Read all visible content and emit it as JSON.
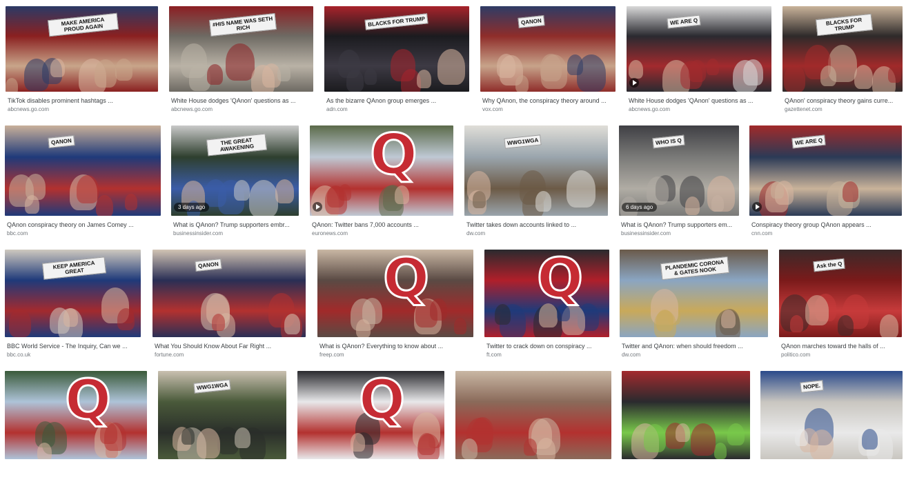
{
  "results": [
    {
      "title": "TikTok disables prominent hashtags ...",
      "source": "abcnews.go.com",
      "sign": "MAKE AMERICA PROUD AGAIN",
      "palette": [
        "#8a2020",
        "#c8a58a",
        "#2b3a66"
      ]
    },
    {
      "title": "White House dodges 'QAnon' questions as ...",
      "source": "abcnews.go.com",
      "sign": "#HIS NAME WAS SETH RICH",
      "palette": [
        "#6e6a63",
        "#b9b2a6",
        "#8c1f23"
      ]
    },
    {
      "title": "As the bizarre QAnon group emerges ...",
      "source": "adn.com",
      "sign": "BLACKS FOR TRUMP",
      "palette": [
        "#1b1b1f",
        "#3d3a44",
        "#a8232b"
      ]
    },
    {
      "title": "Why QAnon, the conspiracy theory around ...",
      "source": "vox.com",
      "sign": "QANON",
      "palette": [
        "#8f2d2a",
        "#c7a38a",
        "#2f3c66"
      ]
    },
    {
      "title": "White House dodges 'QAnon' questions as ...",
      "source": "abcnews.go.com",
      "sign": "WE ARE Q",
      "palette": [
        "#2a2a30",
        "#a32a2e",
        "#d9d9d9"
      ],
      "video": true
    },
    {
      "title": "QAnon' conspiracy theory gains curre...",
      "source": "gazettenet.com",
      "sign": "BLACKS FOR TRUMP",
      "palette": [
        "#2e2a2a",
        "#a12a2a",
        "#c9b39a"
      ]
    },
    {
      "title": "QAnon conspiracy theory on James Comey ...",
      "source": "bbc.com",
      "sign": "QANON",
      "palette": [
        "#1f3a7a",
        "#b3312f",
        "#c9b09a"
      ]
    },
    {
      "title": "What is QAnon? Trump supporters embr...",
      "source": "businessinsider.com",
      "sign": "THE GREAT AWAKENING",
      "palette": [
        "#2e3f2e",
        "#3b5ca8",
        "#c9c9c9"
      ],
      "badge": "3 days ago"
    },
    {
      "title": "QAnon: Twitter bans 7,000 accounts ...",
      "source": "euronews.com",
      "sign": "Q",
      "palette": [
        "#bfc9d4",
        "#b3312f",
        "#5b6a4a"
      ],
      "video": true
    },
    {
      "title": "Twitter takes down accounts linked to ...",
      "source": "dw.com",
      "sign": "WWG1WGA",
      "palette": [
        "#9aa5ad",
        "#6c5a46",
        "#e0ded8"
      ]
    },
    {
      "title": "What is QAnon? Trump supporters em...",
      "source": "businessinsider.com",
      "sign": "WHO IS Q",
      "palette": [
        "#7a7a78",
        "#b0aca4",
        "#3f3f44"
      ],
      "badge": "6 days ago"
    },
    {
      "title": "Conspiracy theory group QAnon appears ...",
      "source": "cnn.com",
      "sign": "WE ARE Q",
      "palette": [
        "#2b3a56",
        "#c9b39a",
        "#a12a2a"
      ],
      "video": true
    },
    {
      "title": "BBC World Service - The Inquiry, Can we ...",
      "source": "bbc.co.uk",
      "sign": "KEEP AMERICA GREAT",
      "palette": [
        "#1f3a7a",
        "#a32a2e",
        "#cfc9bf"
      ]
    },
    {
      "title": "What You Should Know About Far Right ...",
      "source": "fortune.com",
      "sign": "QANON",
      "palette": [
        "#2a2f55",
        "#b3312f",
        "#d2c4b4"
      ]
    },
    {
      "title": "What is QAnon? Everything to know about ...",
      "source": "freep.com",
      "sign": "Q",
      "palette": [
        "#5a4a44",
        "#a12a2a",
        "#c9b7a4"
      ]
    },
    {
      "title": "Twitter to crack down on conspiracy ...",
      "source": "ft.com",
      "sign": "Q",
      "palette": [
        "#b01f2a",
        "#1f3a7a",
        "#2a2a2e"
      ]
    },
    {
      "title": "Twitter and QAnon: when should freedom ...",
      "source": "dw.com",
      "sign": "PLANDEMIC CORONA & GATES NOOK",
      "palette": [
        "#8aa5c2",
        "#c9a95a",
        "#6a5a4a"
      ]
    },
    {
      "title": "QAnon marches toward the halls of ...",
      "source": "politico.com",
      "sign": "Ask the Q",
      "palette": [
        "#7a1a1a",
        "#c73b3b",
        "#3a2a2a"
      ]
    },
    {
      "title": "",
      "source": "",
      "sign": "Q",
      "palette": [
        "#aec3d8",
        "#b3312f",
        "#3a5a3a"
      ]
    },
    {
      "title": "",
      "source": "",
      "sign": "WWG1WGA",
      "palette": [
        "#4a5a3a",
        "#2a2e2a",
        "#c9c0b0"
      ]
    },
    {
      "title": "",
      "source": "",
      "sign": "Q",
      "palette": [
        "#e8e8ea",
        "#b3312f",
        "#2a2a2e"
      ]
    },
    {
      "title": "",
      "source": "",
      "sign": "",
      "palette": [
        "#8a6a5a",
        "#b3312f",
        "#c9b7a4"
      ]
    },
    {
      "title": "",
      "source": "",
      "sign": "",
      "palette": [
        "#2a2a2e",
        "#79c94a",
        "#a32a2e"
      ]
    },
    {
      "title": "",
      "source": "",
      "sign": "NOPE.",
      "palette": [
        "#c9c6c0",
        "#e9e9e9",
        "#2a4a8a"
      ]
    }
  ]
}
